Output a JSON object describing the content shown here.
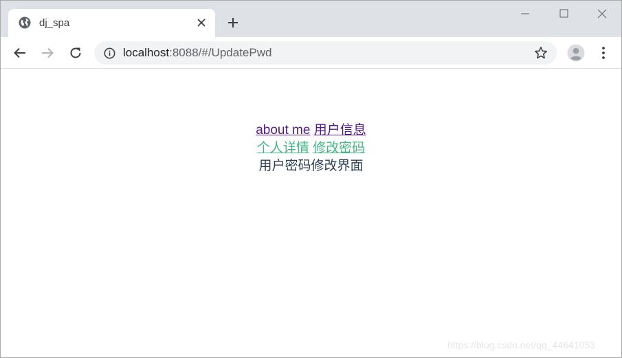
{
  "browser": {
    "tab_title": "dj_spa",
    "url_host": "localhost",
    "url_rest": ":8088/#/UpdatePwd"
  },
  "icons": {
    "favicon": "globe-icon",
    "tab_close": "close-icon",
    "new_tab": "plus-icon",
    "back": "arrow-left-icon",
    "forward": "arrow-right-icon",
    "reload": "reload-icon",
    "site_info": "info-icon",
    "bookmark": "star-icon",
    "profile": "avatar-icon",
    "menu": "kebab-menu-icon"
  },
  "page": {
    "nav_primary": [
      {
        "label": "about me"
      },
      {
        "label": "用户信息"
      }
    ],
    "nav_secondary": [
      {
        "label": "个人详情"
      },
      {
        "label": "修改密码"
      }
    ],
    "view_text": "用户密码修改界面"
  },
  "watermark": "https://blog.csdn.net/qq_44641053",
  "colors": {
    "visited_link": "#551a8b",
    "active_link": "#42b983",
    "text": "#2c3e50",
    "tabstrip": "#dee1e6"
  }
}
